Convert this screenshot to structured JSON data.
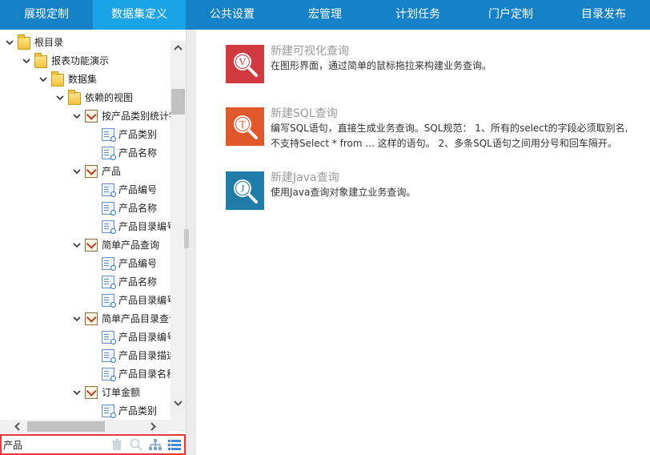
{
  "nav": {
    "tabs": [
      {
        "label": "展现定制"
      },
      {
        "label": "数据集定义"
      },
      {
        "label": "公共设置"
      },
      {
        "label": "宏管理"
      },
      {
        "label": "计划任务"
      },
      {
        "label": "门户定制"
      },
      {
        "label": "目录发布"
      }
    ],
    "active_index": 1
  },
  "tree": {
    "nodes": [
      {
        "label": "根目录",
        "icon": "folder-icon",
        "expanded": true
      },
      {
        "label": "报表功能演示",
        "icon": "folder-icon",
        "expanded": true
      },
      {
        "label": "数据集",
        "icon": "folder-icon",
        "expanded": true
      },
      {
        "label": "依赖的视图",
        "icon": "folder-icon",
        "expanded": true
      },
      {
        "label": "按产品类别统计销",
        "icon": "query-icon",
        "expanded": true
      },
      {
        "label": "产品类别",
        "icon": "field-icon"
      },
      {
        "label": "产品名称",
        "icon": "field-icon"
      },
      {
        "label": "产品",
        "icon": "query-icon",
        "expanded": true
      },
      {
        "label": "产品编号",
        "icon": "field-icon"
      },
      {
        "label": "产品名称",
        "icon": "field-icon"
      },
      {
        "label": "产品目录编号",
        "icon": "field-icon"
      },
      {
        "label": "简单产品查询",
        "icon": "query-icon",
        "expanded": true
      },
      {
        "label": "产品编号",
        "icon": "field-icon"
      },
      {
        "label": "产品名称",
        "icon": "field-icon"
      },
      {
        "label": "产品目录编号",
        "icon": "field-icon"
      },
      {
        "label": "简单产品目录查询",
        "icon": "query-icon",
        "expanded": true
      },
      {
        "label": "产品目录编号",
        "icon": "field-icon"
      },
      {
        "label": "产品目录描述",
        "icon": "field-icon"
      },
      {
        "label": "产品目录名称",
        "icon": "field-icon"
      },
      {
        "label": "订单金额",
        "icon": "query-icon",
        "expanded": true
      },
      {
        "label": "产品类别",
        "icon": "field-icon"
      }
    ]
  },
  "search": {
    "value": "产品"
  },
  "toolbar_icons": [
    "trash-icon",
    "search-icon",
    "hierarchy-icon",
    "list-icon"
  ],
  "cards": [
    {
      "title": "新建可视化查询",
      "desc": "在图形界面，通过简单的鼠标拖拉来构建业务查询。",
      "letter": "V",
      "color": "#d0393e"
    },
    {
      "title": "新建SQL查询",
      "desc": "编写SQL语句，直接生成业务查询。SQL规范： 1、所有的select的字段必须取别名,不支持Select * from ... 这样的语句。 2、多条SQL语句之间用分号和回车隔开。",
      "letter": "T",
      "color": "#e0572a"
    },
    {
      "title": "新建Java查询",
      "desc": "使用Java查询对象建立业务查询。",
      "letter": "J",
      "color": "#1f7ba8"
    }
  ]
}
